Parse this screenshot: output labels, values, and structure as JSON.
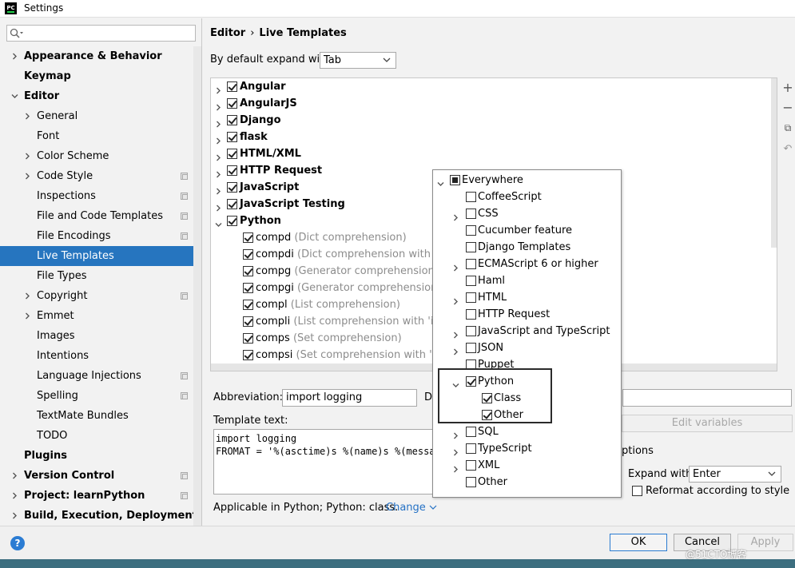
{
  "window": {
    "title": "Settings",
    "app_icon": "PC"
  },
  "sidebar": {
    "search_placeholder": "",
    "items": [
      {
        "label": "Appearance & Behavior",
        "bold": true,
        "arrow": "right",
        "indent": 0
      },
      {
        "label": "Keymap",
        "bold": true,
        "arrow": "",
        "indent": 0
      },
      {
        "label": "Editor",
        "bold": true,
        "arrow": "down",
        "indent": 0
      },
      {
        "label": "General",
        "bold": false,
        "arrow": "right",
        "indent": 1
      },
      {
        "label": "Font",
        "bold": false,
        "arrow": "",
        "indent": 1
      },
      {
        "label": "Color Scheme",
        "bold": false,
        "arrow": "right",
        "indent": 1
      },
      {
        "label": "Code Style",
        "bold": false,
        "arrow": "right",
        "indent": 1,
        "project": true
      },
      {
        "label": "Inspections",
        "bold": false,
        "arrow": "",
        "indent": 1,
        "project": true
      },
      {
        "label": "File and Code Templates",
        "bold": false,
        "arrow": "",
        "indent": 1,
        "project": true
      },
      {
        "label": "File Encodings",
        "bold": false,
        "arrow": "",
        "indent": 1,
        "project": true
      },
      {
        "label": "Live Templates",
        "bold": false,
        "arrow": "",
        "indent": 1,
        "selected": true
      },
      {
        "label": "File Types",
        "bold": false,
        "arrow": "",
        "indent": 1
      },
      {
        "label": "Copyright",
        "bold": false,
        "arrow": "right",
        "indent": 1,
        "project": true
      },
      {
        "label": "Emmet",
        "bold": false,
        "arrow": "right",
        "indent": 1
      },
      {
        "label": "Images",
        "bold": false,
        "arrow": "",
        "indent": 1
      },
      {
        "label": "Intentions",
        "bold": false,
        "arrow": "",
        "indent": 1
      },
      {
        "label": "Language Injections",
        "bold": false,
        "arrow": "",
        "indent": 1,
        "project": true
      },
      {
        "label": "Spelling",
        "bold": false,
        "arrow": "",
        "indent": 1,
        "project": true
      },
      {
        "label": "TextMate Bundles",
        "bold": false,
        "arrow": "",
        "indent": 1
      },
      {
        "label": "TODO",
        "bold": false,
        "arrow": "",
        "indent": 1
      },
      {
        "label": "Plugins",
        "bold": true,
        "arrow": "",
        "indent": 0
      },
      {
        "label": "Version Control",
        "bold": true,
        "arrow": "right",
        "indent": 0,
        "project": true
      },
      {
        "label": "Project: learnPython",
        "bold": true,
        "arrow": "right",
        "indent": 0,
        "project": true
      },
      {
        "label": "Build, Execution, Deployment",
        "bold": true,
        "arrow": "right",
        "indent": 0
      }
    ]
  },
  "main": {
    "breadcrumb": {
      "parent": "Editor",
      "sep": "›",
      "current": "Live Templates"
    },
    "expand_label": "By default expand with",
    "expand_value": "Tab",
    "template_groups": [
      {
        "name": "Angular",
        "expanded": false
      },
      {
        "name": "AngularJS",
        "expanded": false
      },
      {
        "name": "Django",
        "expanded": false
      },
      {
        "name": "flask",
        "expanded": false
      },
      {
        "name": "HTML/XML",
        "expanded": false
      },
      {
        "name": "HTTP Request",
        "expanded": false
      },
      {
        "name": "JavaScript",
        "expanded": false
      },
      {
        "name": "JavaScript Testing",
        "expanded": false
      },
      {
        "name": "Python",
        "expanded": true
      }
    ],
    "python_templates": [
      {
        "abbr": "compd",
        "desc": "(Dict comprehension)"
      },
      {
        "abbr": "compdi",
        "desc": "(Dict comprehension with 'if')"
      },
      {
        "abbr": "compg",
        "desc": "(Generator comprehension)"
      },
      {
        "abbr": "compgi",
        "desc": "(Generator comprehension wi"
      },
      {
        "abbr": "compl",
        "desc": "(List comprehension)"
      },
      {
        "abbr": "compli",
        "desc": "(List comprehension with 'if')"
      },
      {
        "abbr": "comps",
        "desc": "(Set comprehension)"
      },
      {
        "abbr": "compsi",
        "desc": "(Set comprehension with 'if')"
      }
    ],
    "abbreviation_label": "Abbreviation:",
    "abbreviation_value": "import logging",
    "description_label": "D",
    "template_text_label": "Template text:",
    "template_text": "import logging\nFROMAT = '%(asctime)s %(name)s %(messag",
    "edit_variables_label": "Edit variables",
    "options_label": "ptions",
    "expand_with_label": "Expand with",
    "expand_with_value": "Enter",
    "reformat_label": "Reformat according to style",
    "applicable_label": "Applicable in Python; Python: class.",
    "change_label": "Change"
  },
  "context_popup": {
    "root": "Everywhere",
    "items": [
      {
        "label": "CoffeeScript",
        "arrow": false,
        "checked": false
      },
      {
        "label": "CSS",
        "arrow": true,
        "checked": false
      },
      {
        "label": "Cucumber feature",
        "arrow": false,
        "checked": false
      },
      {
        "label": "Django Templates",
        "arrow": false,
        "checked": false
      },
      {
        "label": "ECMAScript 6 or higher",
        "arrow": true,
        "checked": false
      },
      {
        "label": "Haml",
        "arrow": false,
        "checked": false
      },
      {
        "label": "HTML",
        "arrow": true,
        "checked": false
      },
      {
        "label": "HTTP Request",
        "arrow": false,
        "checked": false
      },
      {
        "label": "JavaScript and TypeScript",
        "arrow": true,
        "checked": false
      },
      {
        "label": "JSON",
        "arrow": true,
        "checked": false
      },
      {
        "label": "Puppet",
        "arrow": false,
        "checked": false
      },
      {
        "label": "Python",
        "arrow": "down",
        "checked": true
      },
      {
        "label": "Class",
        "arrow": false,
        "checked": true,
        "child": true
      },
      {
        "label": "Other",
        "arrow": false,
        "checked": true,
        "child": true
      },
      {
        "label": "SQL",
        "arrow": true,
        "checked": false
      },
      {
        "label": "TypeScript",
        "arrow": true,
        "checked": false
      },
      {
        "label": "XML",
        "arrow": true,
        "checked": false
      },
      {
        "label": "Other",
        "arrow": false,
        "checked": false
      }
    ]
  },
  "footer": {
    "ok_label": "OK",
    "cancel_label": "Cancel",
    "apply_label": "Apply",
    "help_label": "?",
    "watermark": "@51CTO博客"
  },
  "colors": {
    "selection": "#2675bf",
    "link": "#2471c5",
    "primary_border": "#2a7bd1"
  }
}
